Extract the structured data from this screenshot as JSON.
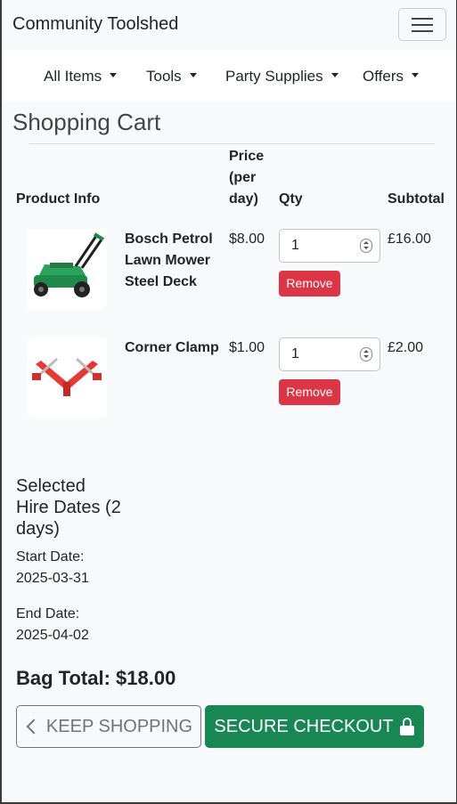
{
  "navbar": {
    "brand": "Community Toolshed",
    "toggler_icon": "hamburger-icon"
  },
  "nav": {
    "items": [
      {
        "label": "All Items"
      },
      {
        "label": "Tools"
      },
      {
        "label": "Party Supplies"
      },
      {
        "label": "Offers"
      }
    ]
  },
  "cart": {
    "title": "Shopping Cart",
    "headers": {
      "product": "Product Info",
      "price": "Price (per day)",
      "qty": "Qty",
      "subtotal": "Subtotal"
    },
    "rows": [
      {
        "name": "Bosch Petrol Lawn Mower Steel Deck",
        "image_icon": "lawn-mower-icon",
        "price": "$8.00",
        "qty": "1",
        "remove": "Remove",
        "subtotal": "£16.00"
      },
      {
        "name": "Corner Clamp",
        "image_icon": "corner-clamp-icon",
        "price": "$1.00",
        "qty": "1",
        "remove": "Remove",
        "subtotal": "£2.00"
      }
    ]
  },
  "dates": {
    "title": "Selected Hire Dates (2 days)",
    "start_label": "Start Date:",
    "start_value": "2025-03-31",
    "end_label": "End Date:",
    "end_value": "2025-04-02"
  },
  "summary": {
    "total": "Bag Total: $18.00"
  },
  "actions": {
    "keep_shopping": "KEEP SHOPPING",
    "checkout": "SECURE CHECKOUT"
  },
  "colors": {
    "checkout": "#198754",
    "remove": "#dc3545",
    "keep_border": "#6c757d"
  }
}
